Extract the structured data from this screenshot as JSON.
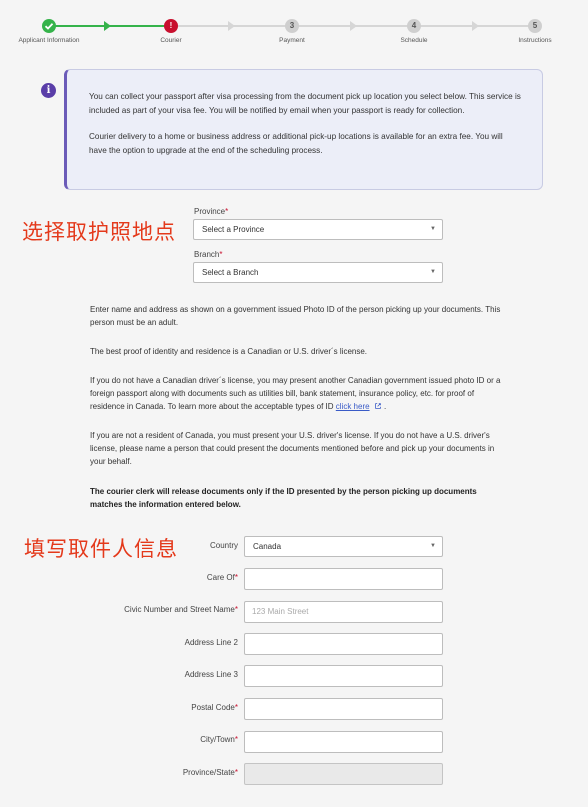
{
  "stepper": {
    "steps": [
      {
        "label": "Applicant Information",
        "number": "",
        "status": "done"
      },
      {
        "label": "Courier",
        "number": "!",
        "status": "error"
      },
      {
        "label": "Payment",
        "number": "3",
        "status": "todo"
      },
      {
        "label": "Schedule",
        "number": "4",
        "status": "todo"
      },
      {
        "label": "Instructions",
        "number": "5",
        "status": "todo"
      }
    ],
    "done_color": "#35b34a",
    "error_color": "#c8102e"
  },
  "info": {
    "icon": "info-icon",
    "para1": "You can collect your passport after visa processing from the document pick up location you select below. This service is included as part of your visa fee. You will be notified by email when your passport is ready for collection.",
    "para2": "Courier delivery to a home or business address or additional pick-up locations is available for an extra fee. You will have the option to upgrade at the end of the scheduling process."
  },
  "annotations": {
    "select_location": "选择取护照地点",
    "fill_info": "填写取件人信息"
  },
  "location": {
    "province_label": "Province",
    "province_value": "Select a Province",
    "branch_label": "Branch",
    "branch_value": "Select a Branch"
  },
  "instructions": {
    "p1": "Enter name and address as shown on a government issued Photo ID of the person picking up your documents. This person must be an adult.",
    "p2": "The best proof of identity and residence is a Canadian or U.S. driver´s license.",
    "p3_before": "If you do not have a Canadian driver´s license, you may present another Canadian government issued photo ID or a foreign passport along with documents such as utilities bill, bank statement, insurance policy, etc. for proof of residence in Canada. To learn more about the acceptable types of ID ",
    "p3_link": "click here",
    "p3_after": ".",
    "p4": "If you are not a resident of Canada, you must present your U.S. driver's license. If you do not have a U.S. driver's license, please name a person that could present the documents mentioned before and pick up your documents in your behalf.",
    "p5": "The courier clerk will release documents only if the ID presented by the person picking up documents matches the information entered below."
  },
  "form": {
    "country_label": "Country",
    "country_value": "Canada",
    "care_of_label": "Care Of",
    "civic_label": "Civic Number and Street Name",
    "civic_placeholder": "123 Main Street",
    "address2_label": "Address Line 2",
    "address3_label": "Address Line 3",
    "postal_label": "Postal Code",
    "city_label": "City/Town",
    "province_state_label": "Province/State",
    "required_mark": "*"
  }
}
